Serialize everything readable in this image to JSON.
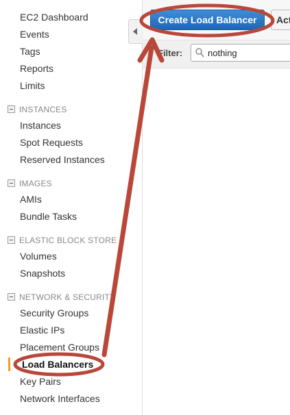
{
  "sidebar": {
    "top_items": [
      "EC2 Dashboard",
      "Events",
      "Tags",
      "Reports",
      "Limits"
    ],
    "sections": [
      {
        "header": "INSTANCES",
        "items": [
          "Instances",
          "Spot Requests",
          "Reserved Instances"
        ]
      },
      {
        "header": "IMAGES",
        "items": [
          "AMIs",
          "Bundle Tasks"
        ]
      },
      {
        "header": "ELASTIC BLOCK STORE",
        "items": [
          "Volumes",
          "Snapshots"
        ]
      },
      {
        "header": "NETWORK & SECURITY",
        "items": [
          "Security Groups",
          "Elastic IPs",
          "Placement Groups",
          "Load Balancers",
          "Key Pairs",
          "Network Interfaces"
        ]
      }
    ],
    "active_item": "Load Balancers"
  },
  "toolbar": {
    "create_label": "Create Load Balancer",
    "actions_label": "Actions"
  },
  "filter": {
    "label": "Filter:",
    "value": "nothing"
  },
  "colors": {
    "primary_button": "#1d66b5",
    "annotation": "#b9473a",
    "active_indicator": "#f0a020"
  }
}
